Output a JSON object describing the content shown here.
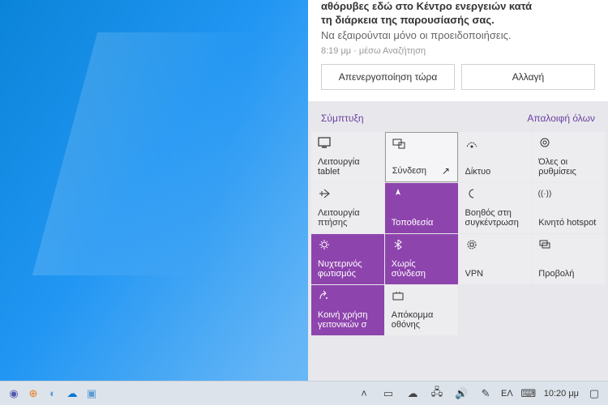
{
  "notification": {
    "title_line1": "αθόρυβες εδώ στο Κέντρο ενεργειών κατά",
    "title_line2": "τη διάρκεια της παρουσίασής σας.",
    "subtitle": "Να εξαιρούνται μόνο οι προειδοποιήσεις.",
    "meta": "8:19 μμ · μέσω Αναζήτηση",
    "btn_disable": "Απενεργοποίηση τώρα",
    "btn_change": "Αλλαγή"
  },
  "panel": {
    "collapse": "Σύμπτυξη",
    "clear": "Απαλοιφή όλων"
  },
  "tiles": [
    {
      "label": "Λειτουργία tablet",
      "icon": "tablet",
      "active": false
    },
    {
      "label": "Σύνδεση",
      "icon": "connect",
      "active": false,
      "hover": true
    },
    {
      "label": "Δίκτυο",
      "icon": "network",
      "active": false
    },
    {
      "label": "Όλες οι ρυθμίσεις",
      "icon": "settings",
      "active": false
    },
    {
      "label": "Λειτουργία πτήσης",
      "icon": "airplane",
      "active": false
    },
    {
      "label": "Τοποθεσία",
      "icon": "location",
      "active": true
    },
    {
      "label": "Βοηθός στη συγκέντρωση",
      "icon": "focus",
      "active": false
    },
    {
      "label": "Κινητό hotspot",
      "icon": "hotspot",
      "active": false
    },
    {
      "label": "Νυχτερινός φωτισμός",
      "icon": "night",
      "active": true
    },
    {
      "label": "Χωρίς σύνδεση",
      "icon": "bluetooth",
      "active": true
    },
    {
      "label": "VPN",
      "icon": "vpn",
      "active": false
    },
    {
      "label": "Προβολή",
      "icon": "project",
      "active": false
    },
    {
      "label": "Κοινή χρήση γειτονικών σ",
      "icon": "share",
      "active": true
    },
    {
      "label": "Απόκομμα οθόνης",
      "icon": "snip",
      "active": false
    }
  ],
  "taskbar": {
    "lang": "ΕΛ",
    "time": "10:20 μμ"
  }
}
